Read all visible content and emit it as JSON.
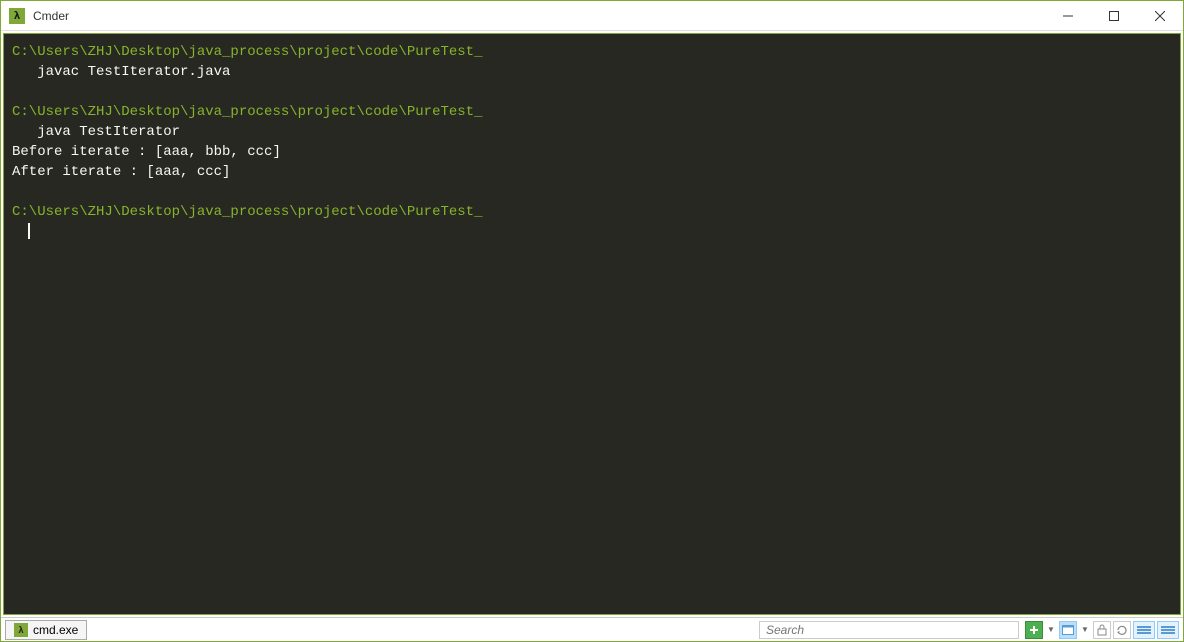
{
  "titlebar": {
    "title": "Cmder",
    "lambda": "λ"
  },
  "terminal": {
    "blocks": [
      {
        "prompt": "C:\\Users\\ZHJ\\Desktop\\java_process\\project\\code\\PureTest_",
        "command": "   javac TestIterator.java",
        "output": []
      },
      {
        "prompt": "C:\\Users\\ZHJ\\Desktop\\java_process\\project\\code\\PureTest_",
        "command": "   java TestIterator",
        "output": [
          "Before iterate : [aaa, bbb, ccc]",
          "After iterate : [aaa, ccc]"
        ]
      },
      {
        "prompt": "C:\\Users\\ZHJ\\Desktop\\java_process\\project\\code\\PureTest_",
        "command": "",
        "output": []
      }
    ]
  },
  "statusbar": {
    "tab_label": "cmd.exe",
    "search_placeholder": "Search",
    "lambda": "λ"
  }
}
